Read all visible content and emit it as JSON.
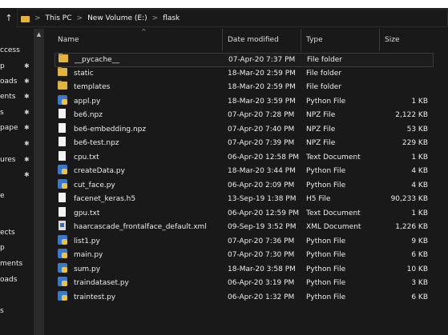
{
  "breadcrumb": {
    "up_glyph": "↑",
    "items": [
      "This PC",
      "New Volume (E:)",
      "flask"
    ]
  },
  "nav": {
    "items": [
      {
        "label": "ccess",
        "pinned": false
      },
      {
        "label": "p",
        "pinned": true
      },
      {
        "label": "oads",
        "pinned": true
      },
      {
        "label": "ents",
        "pinned": true
      },
      {
        "label": "s",
        "pinned": true
      },
      {
        "label": "pape",
        "pinned": true
      },
      {
        "label": "",
        "pinned": true
      },
      {
        "label": "ures",
        "pinned": true
      },
      {
        "label": "",
        "pinned": true
      },
      {
        "label": "e",
        "pinned": false
      },
      {
        "label": "ects",
        "pinned": false
      },
      {
        "label": "p",
        "pinned": false
      },
      {
        "label": "ments",
        "pinned": false
      },
      {
        "label": "oads",
        "pinned": false
      },
      {
        "label": "s",
        "pinned": false
      }
    ]
  },
  "columns": {
    "name": "Name",
    "date": "Date modified",
    "type": "Type",
    "size": "Size"
  },
  "files": [
    {
      "name": "__pycache__",
      "date": "07-Apr-20 7:37 PM",
      "type": "File folder",
      "size": "",
      "icon": "folder-icon",
      "selected": true
    },
    {
      "name": "static",
      "date": "18-Mar-20 2:59 PM",
      "type": "File folder",
      "size": "",
      "icon": "folder-icon",
      "selected": false
    },
    {
      "name": "templates",
      "date": "18-Mar-20 2:59 PM",
      "type": "File folder",
      "size": "",
      "icon": "folder-icon",
      "selected": false
    },
    {
      "name": "appl.py",
      "date": "18-Mar-20 3:59 PM",
      "type": "Python File",
      "size": "1 KB",
      "icon": "python-file-icon",
      "selected": false
    },
    {
      "name": "be6.npz",
      "date": "07-Apr-20 7:28 PM",
      "type": "NPZ File",
      "size": "2,122 KB",
      "icon": "file-icon",
      "selected": false
    },
    {
      "name": "be6-embedding.npz",
      "date": "07-Apr-20 7:40 PM",
      "type": "NPZ File",
      "size": "53 KB",
      "icon": "file-icon",
      "selected": false
    },
    {
      "name": "be6-test.npz",
      "date": "07-Apr-20 7:39 PM",
      "type": "NPZ File",
      "size": "229 KB",
      "icon": "file-icon",
      "selected": false
    },
    {
      "name": "cpu.txt",
      "date": "06-Apr-20 12:58 PM",
      "type": "Text Document",
      "size": "1 KB",
      "icon": "file-icon",
      "selected": false
    },
    {
      "name": "createData.py",
      "date": "18-Mar-20 3:44 PM",
      "type": "Python File",
      "size": "4 KB",
      "icon": "python-file-icon",
      "selected": false
    },
    {
      "name": "cut_face.py",
      "date": "06-Apr-20 2:09 PM",
      "type": "Python File",
      "size": "4 KB",
      "icon": "python-file-icon",
      "selected": false
    },
    {
      "name": "facenet_keras.h5",
      "date": "13-Sep-19 1:38 PM",
      "type": "H5 File",
      "size": "90,233 KB",
      "icon": "file-icon",
      "selected": false
    },
    {
      "name": "gpu.txt",
      "date": "06-Apr-20 12:59 PM",
      "type": "Text Document",
      "size": "1 KB",
      "icon": "file-icon",
      "selected": false
    },
    {
      "name": "haarcascade_frontalface_default.xml",
      "date": "09-Sep-19 3:52 PM",
      "type": "XML Document",
      "size": "1,226 KB",
      "icon": "xml-file-icon",
      "selected": false
    },
    {
      "name": "list1.py",
      "date": "07-Apr-20 7:36 PM",
      "type": "Python File",
      "size": "9 KB",
      "icon": "python-file-icon",
      "selected": false
    },
    {
      "name": "main.py",
      "date": "07-Apr-20 7:30 PM",
      "type": "Python File",
      "size": "6 KB",
      "icon": "python-file-icon",
      "selected": false
    },
    {
      "name": "sum.py",
      "date": "18-Mar-20 3:58 PM",
      "type": "Python File",
      "size": "10 KB",
      "icon": "python-file-icon",
      "selected": false
    },
    {
      "name": "traindataset.py",
      "date": "06-Apr-20 3:19 PM",
      "type": "Python File",
      "size": "3 KB",
      "icon": "python-file-icon",
      "selected": false
    },
    {
      "name": "traintest.py",
      "date": "06-Apr-20 1:32 PM",
      "type": "Python File",
      "size": "6 KB",
      "icon": "python-file-icon",
      "selected": false
    }
  ]
}
